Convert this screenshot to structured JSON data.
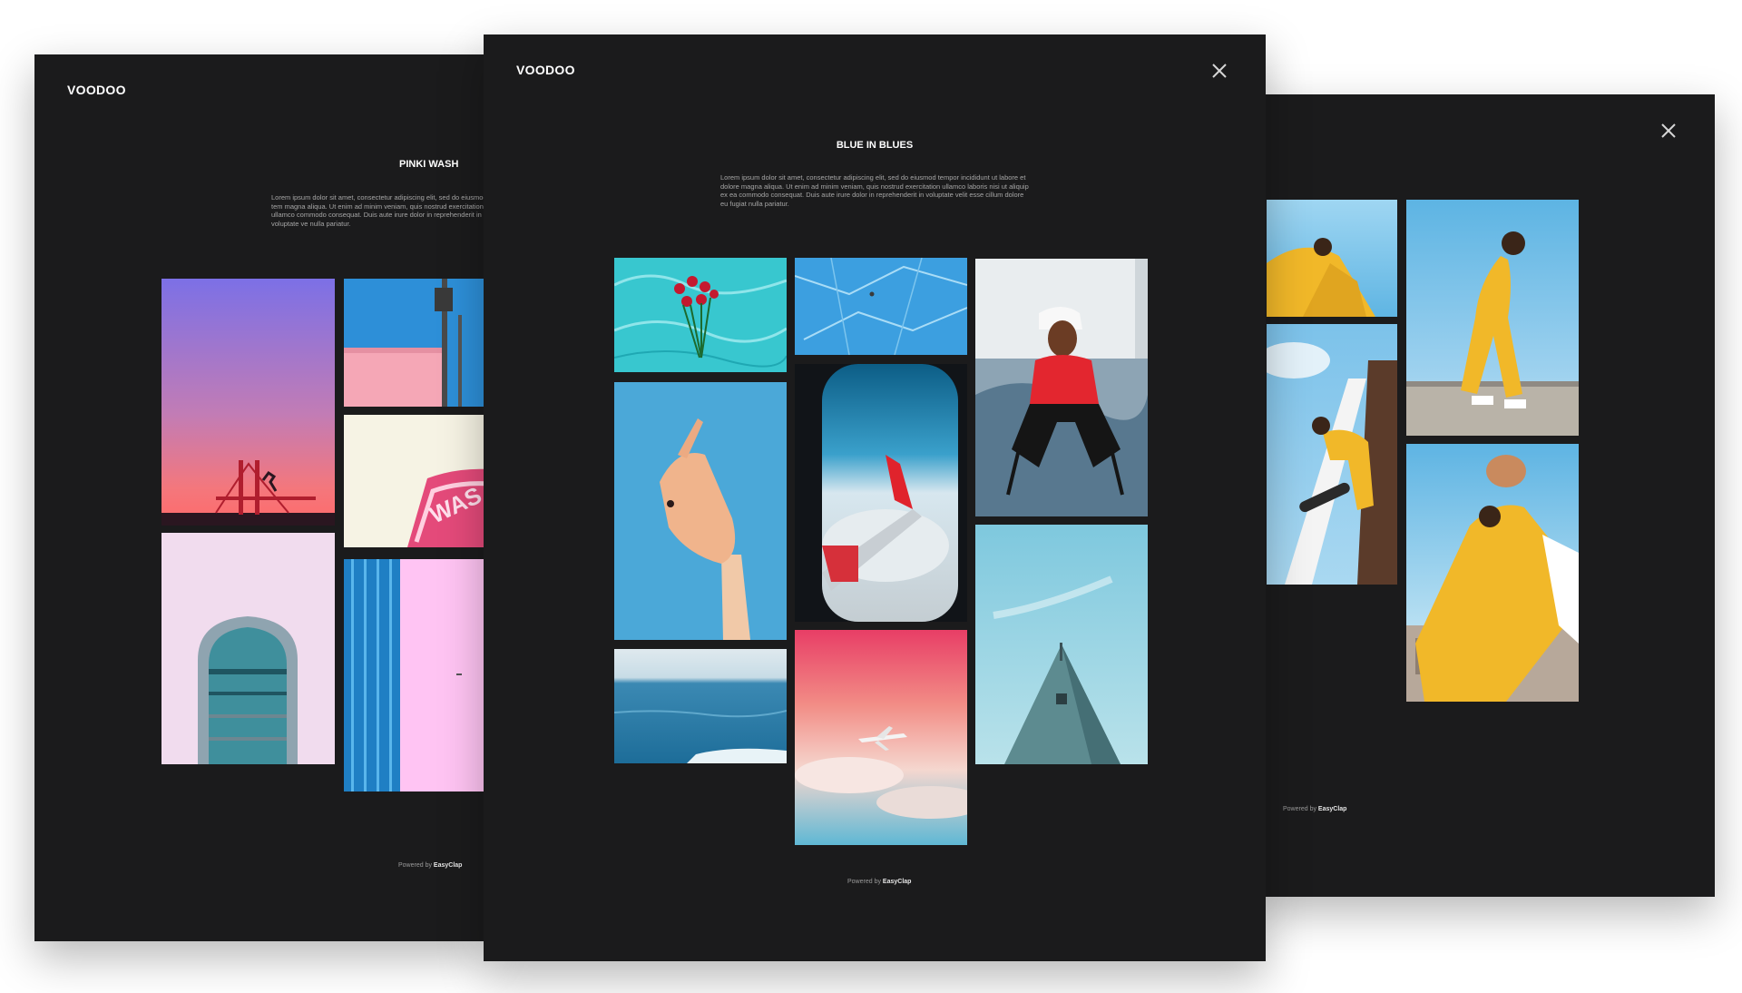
{
  "screens": {
    "left": {
      "brand": "VOODOO",
      "title": "PINKI WASH",
      "description": "Lorem ipsum dolor sit amet, consectetur adipiscing elit, sed do eiusmod tem magna aliqua. Ut enim ad minim veniam, quis nostrud exercitation ullamco commodo consequat. Duis aute irure dolor in reprehenderit in voluptate ve nulla pariatur.",
      "powered_prefix": "Powered by",
      "powered_brand": "EasyClap"
    },
    "center": {
      "brand": "VOODOO",
      "title": "BLUE IN BLUES",
      "description": "Lorem ipsum dolor sit amet, consectetur adipiscing elit, sed do eiusmod tempor incididunt ut labore et dolore magna aliqua. Ut enim ad minim veniam, quis nostrud exercitation ullamco laboris nisi ut aliquip ex ea commodo consequat. Duis aute irure dolor in reprehenderit in voluptate velit esse cillum dolore eu fugiat nulla pariatur.",
      "powered_prefix": "Powered by",
      "powered_brand": "EasyClap",
      "close_icon": "close-icon"
    },
    "right": {
      "powered_prefix": "Powered by",
      "powered_brand": "EasyClap",
      "close_icon": "close-icon"
    }
  },
  "colors": {
    "background": "#ffffff",
    "panel": "#1b1b1c",
    "text": "#ffffff",
    "muted_text": "#a6a6a6"
  }
}
